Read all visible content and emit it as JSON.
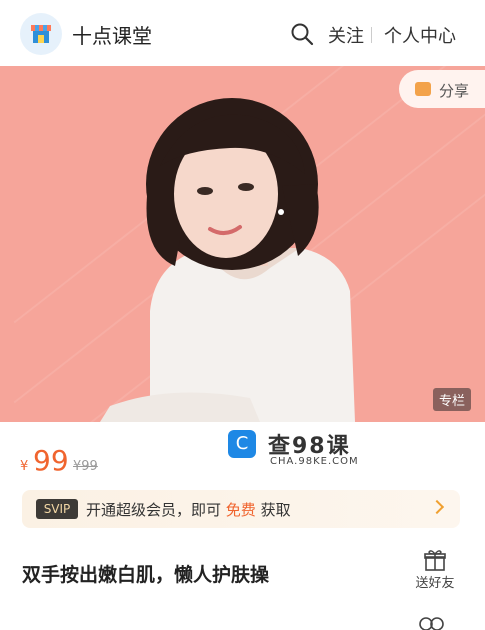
{
  "header": {
    "app_name": "十点课堂",
    "follow": "关注",
    "user_center": "个人中心"
  },
  "hero": {
    "share": "分享",
    "tag": "专栏"
  },
  "price": {
    "currency": "¥",
    "current": "99",
    "original": "¥99"
  },
  "watermark": {
    "title": "查98课",
    "subtitle": "CHA.98KE.COM"
  },
  "svip": {
    "badge": "SVIP",
    "text_prefix": "开通超级会员，即可",
    "text_free": "免费",
    "text_suffix": "获取"
  },
  "course": {
    "title": "双手按出嫩白肌，懒人护肤操"
  },
  "gift": {
    "label": "送好友"
  },
  "colors": {
    "accent": "#f0642e",
    "hero_bg": "#f6a59a",
    "svip_badge_bg": "#3d3a36"
  }
}
